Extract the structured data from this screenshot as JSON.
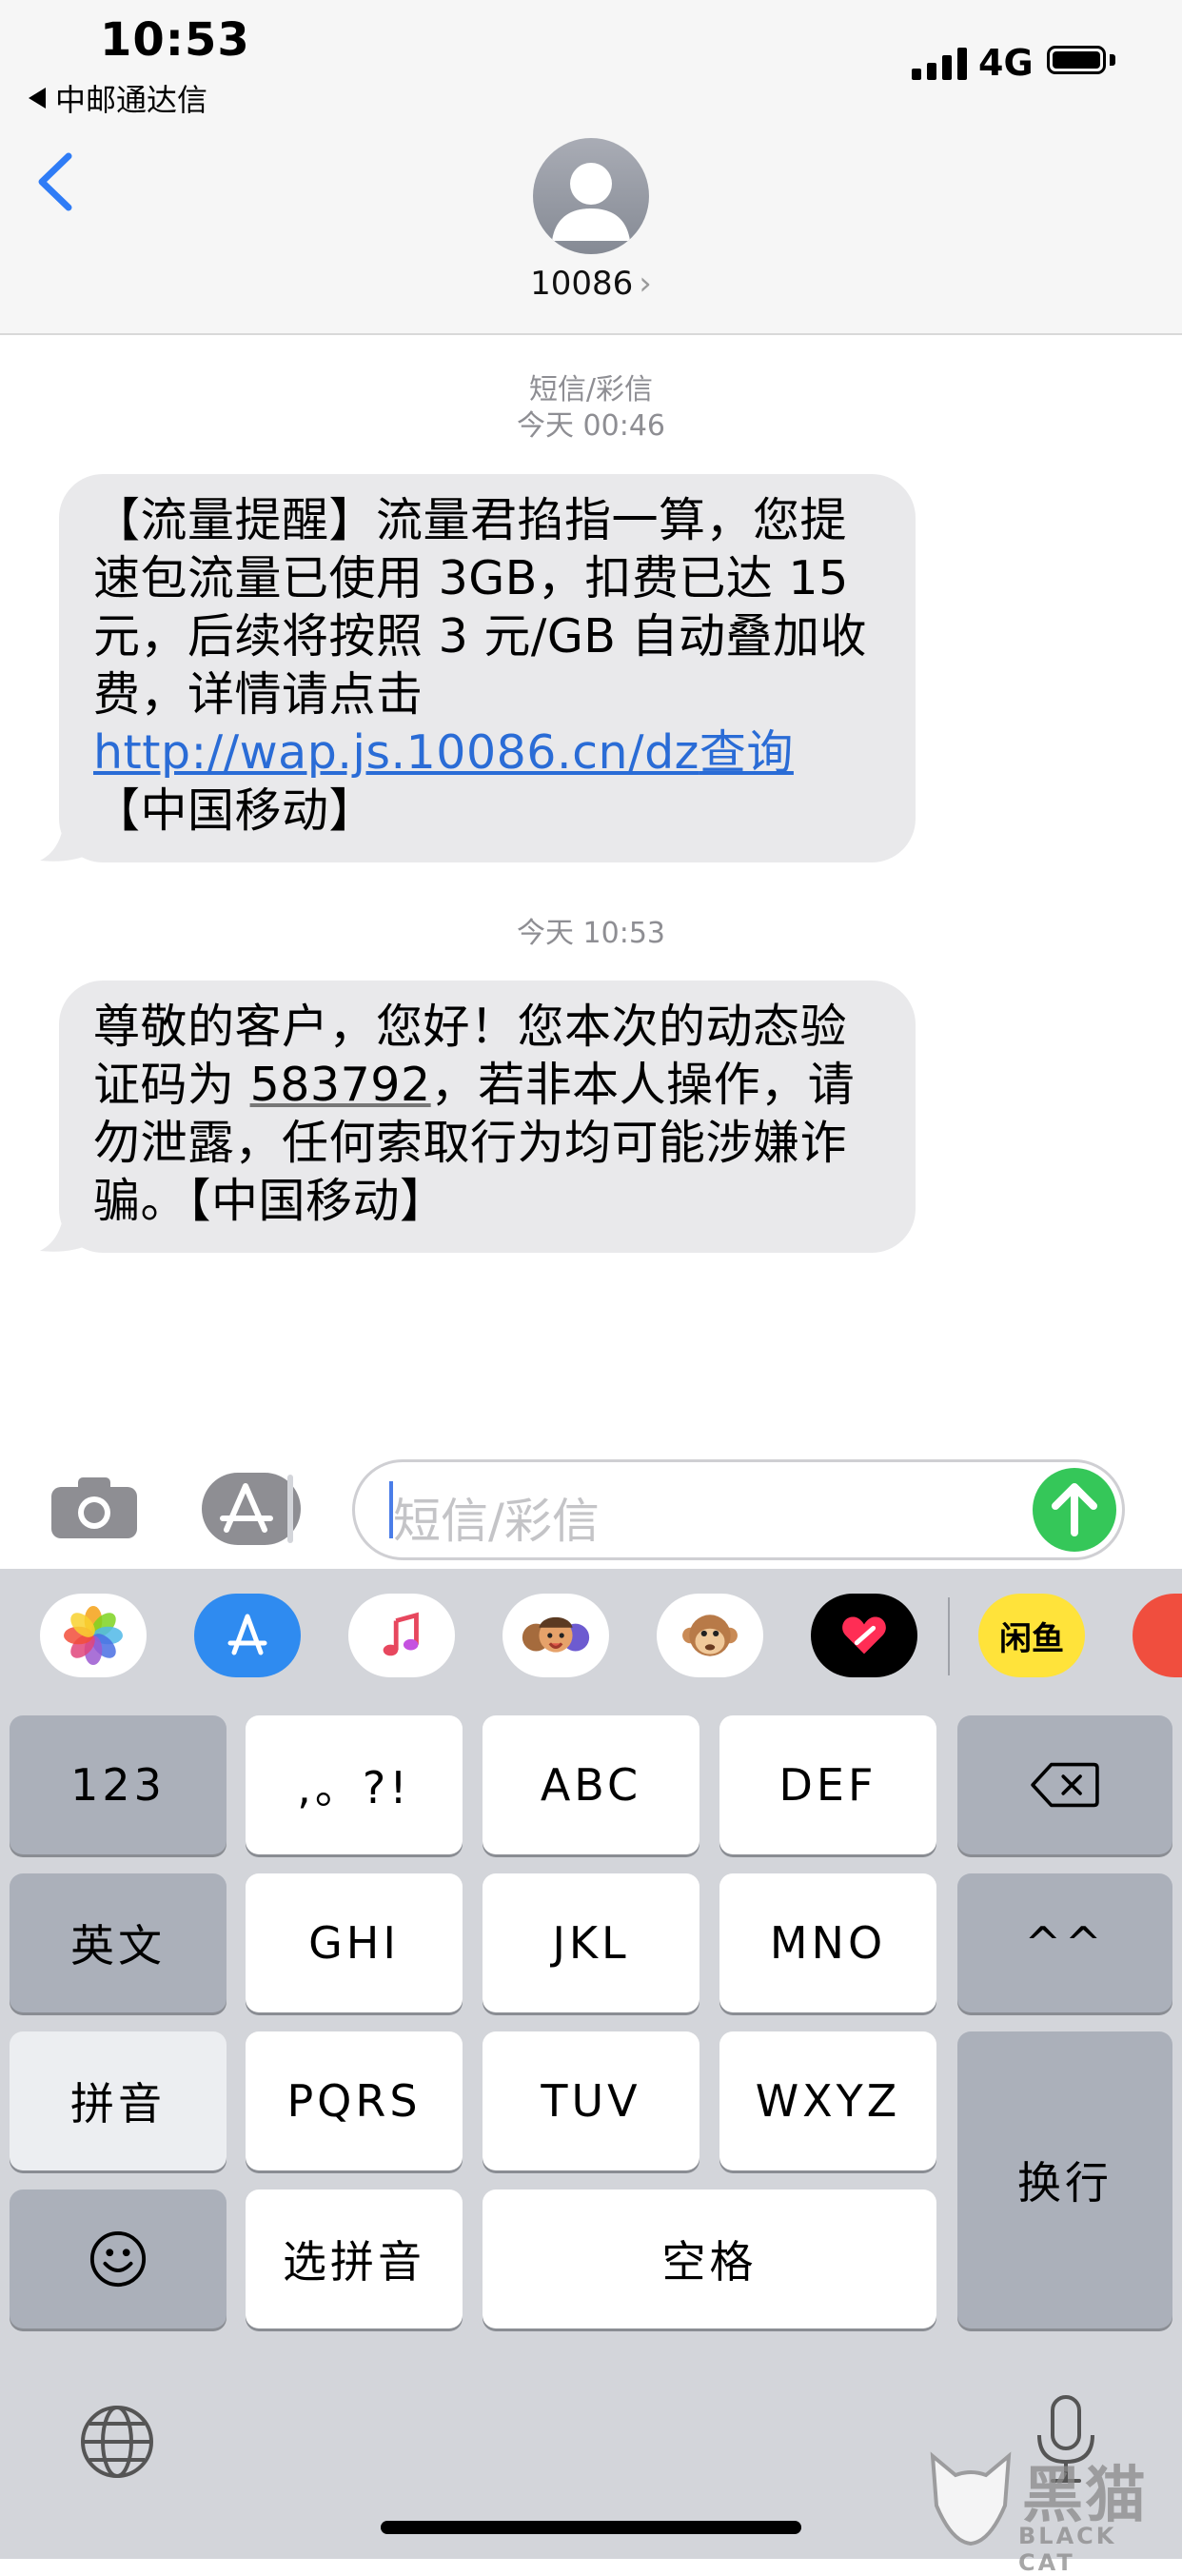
{
  "status_bar": {
    "time": "10:53",
    "back_app": "中邮通达信",
    "network": "4G"
  },
  "contact": {
    "name": "10086",
    "chevron": "›"
  },
  "messages": {
    "type_label": "短信/彩信",
    "first_timestamp": "今天 00:46",
    "second_timestamp": "今天 10:53",
    "msg1": {
      "prefix": "【流量提醒】流量君掐指一算，您提速包流量已使用 3GB，扣费已达 15 元，后续将按照 3 元/GB 自动叠加收费，详情请点击 ",
      "link": "http://wap.js.10086.cn/dz",
      "link_word": "查询",
      "suffix": "【中国移动】"
    },
    "msg2": {
      "prefix": "尊敬的客户，您好！您本次的动态验证码为 ",
      "code": "583792",
      "suffix": "，若非本人操作，请勿泄露，任何索取行为均可能涉嫌诈骗。【中国移动】"
    }
  },
  "input": {
    "placeholder": "短信/彩信"
  },
  "app_strip": {
    "items": [
      "photos-icon",
      "app-store-icon",
      "music-icon",
      "memoji-icon",
      "animoji-icon",
      "digital-touch-icon",
      "xianyu-icon",
      "partial-app-icon"
    ],
    "xianyu_label": "闲鱼"
  },
  "keyboard": {
    "row1": [
      "123",
      ",。?!",
      "ABC",
      "DEF"
    ],
    "row2": [
      "英文",
      "GHI",
      "JKL",
      "MNO",
      "^^"
    ],
    "row3": [
      "拼音",
      "PQRS",
      "TUV",
      "WXYZ"
    ],
    "row4": [
      "选拼音",
      "空格"
    ],
    "return": "换行"
  },
  "watermark": {
    "text": "黑猫",
    "subtext": "BLACK CAT"
  },
  "colors": {
    "bubble": "#e9e9eb",
    "link": "#2a6cd6",
    "send": "#35c759",
    "accent": "#2f7cf6"
  }
}
